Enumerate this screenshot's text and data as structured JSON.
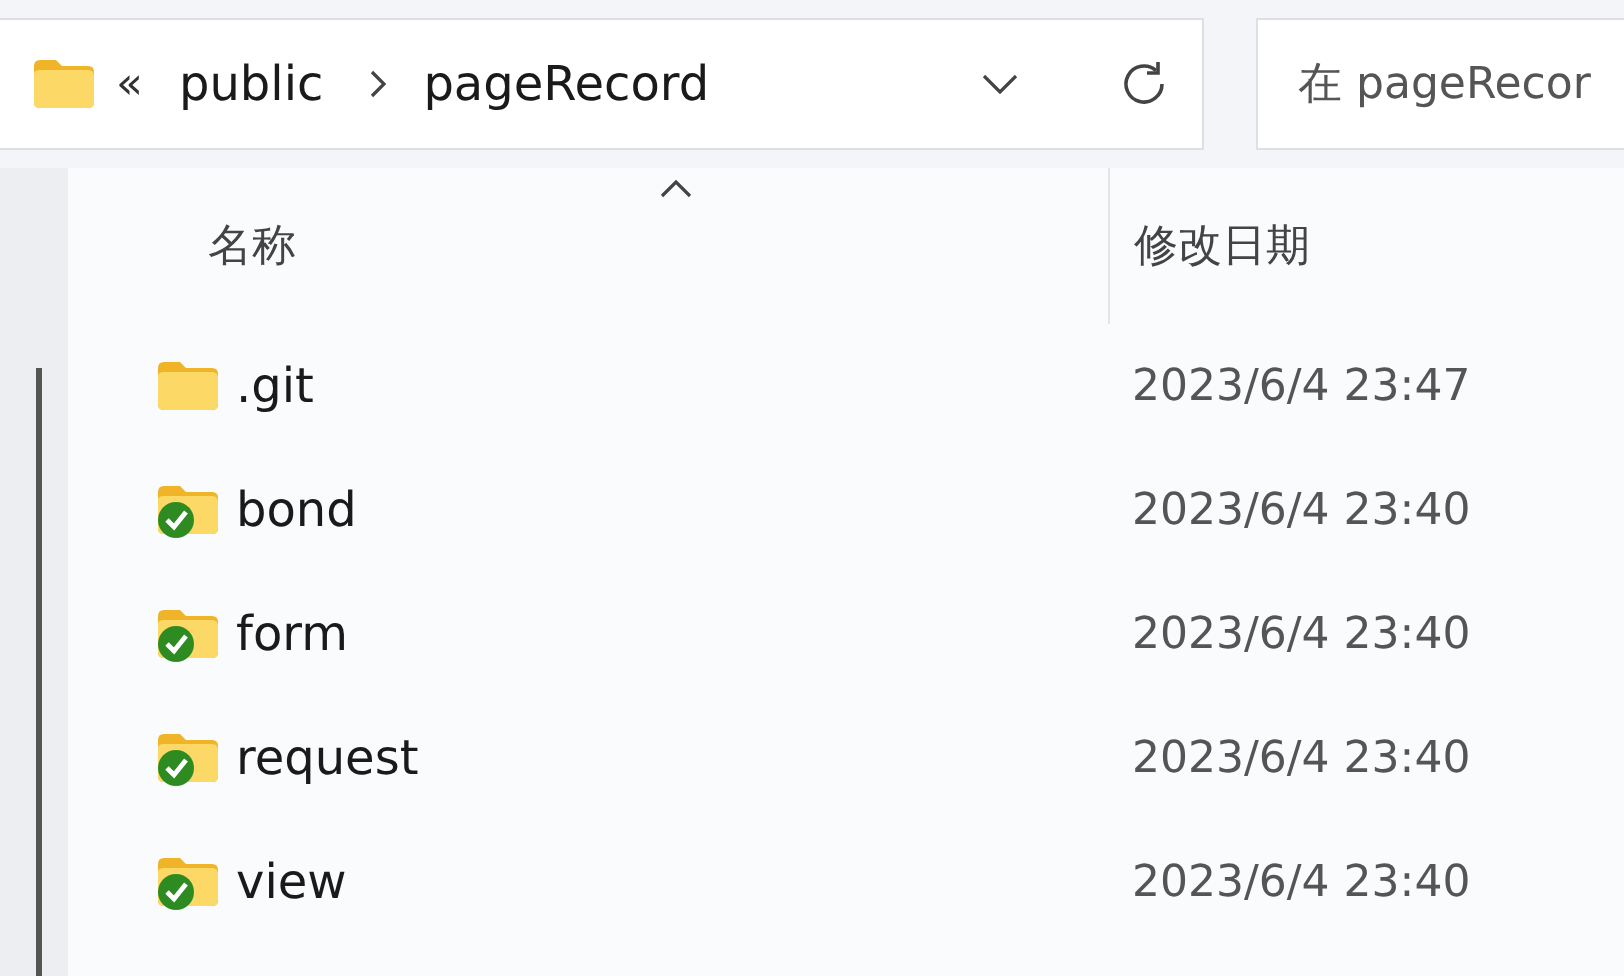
{
  "address_bar": {
    "overflow": "«",
    "crumbs": [
      "public",
      "pageRecord"
    ]
  },
  "search": {
    "placeholder": "在 pageRecor"
  },
  "columns": [
    {
      "label": "名称",
      "sorted": true
    },
    {
      "label": "修改日期",
      "sorted": false
    }
  ],
  "rows": [
    {
      "name": ".git",
      "modified": "2023/6/4 23:47",
      "kind": "plain"
    },
    {
      "name": "bond",
      "modified": "2023/6/4 23:40",
      "kind": "synced"
    },
    {
      "name": "form",
      "modified": "2023/6/4 23:40",
      "kind": "synced"
    },
    {
      "name": "request",
      "modified": "2023/6/4 23:40",
      "kind": "synced"
    },
    {
      "name": "view",
      "modified": "2023/6/4 23:40",
      "kind": "synced"
    }
  ]
}
